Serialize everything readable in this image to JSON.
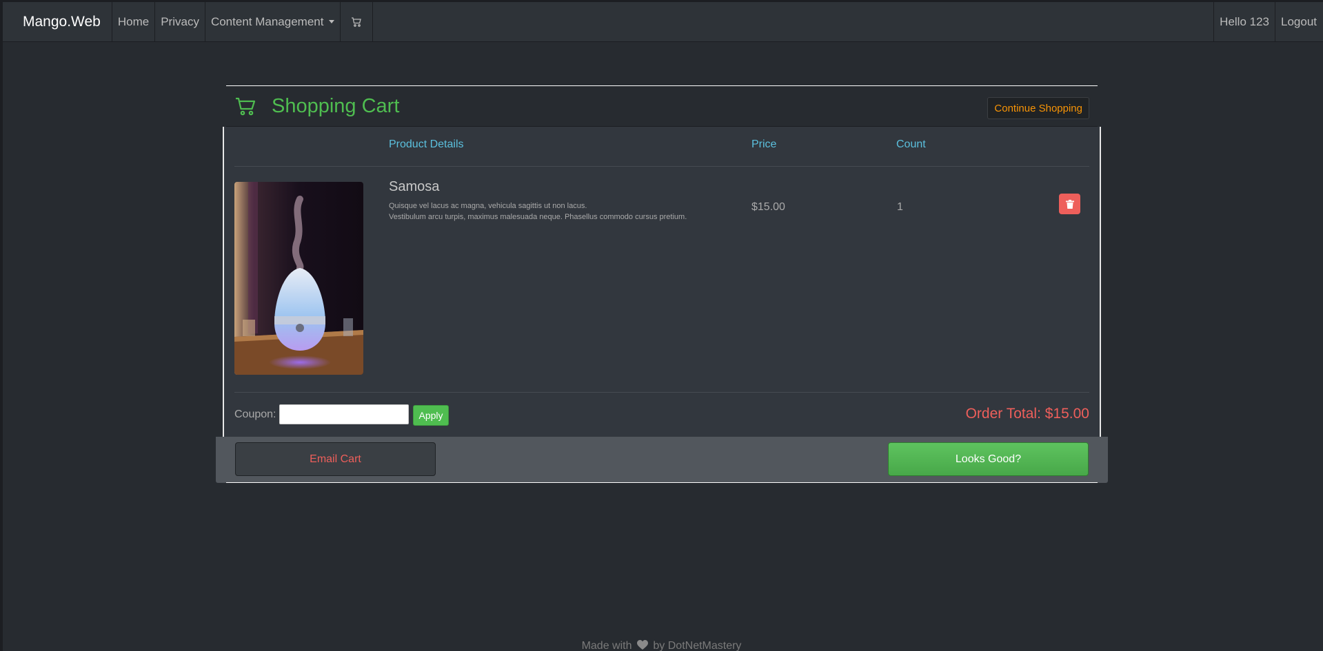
{
  "navbar": {
    "brand": "Mango.Web",
    "links": [
      "Home",
      "Privacy"
    ],
    "dropdown_label": "Content Management",
    "greeting": "Hello 123",
    "logout": "Logout"
  },
  "cart": {
    "title": "Shopping Cart",
    "continue_label": "Continue Shopping",
    "columns": {
      "details": "Product Details",
      "price": "Price",
      "count": "Count"
    },
    "items": [
      {
        "name": "Samosa",
        "description_line1": "Quisque vel lacus ac magna, vehicula sagittis ut non lacus.",
        "description_line2": "Vestibulum arcu turpis, maximus malesuada neque. Phasellus commodo cursus pretium.",
        "price": "$15.00",
        "count": "1"
      }
    ],
    "coupon_label": "Coupon:",
    "coupon_value": "",
    "apply_label": "Apply",
    "order_total": "Order Total: $15.00",
    "email_label": "Email Cart",
    "checkout_label": "Looks Good?"
  },
  "footer": {
    "prefix": "Made with",
    "suffix": "by DotNetMastery"
  },
  "colors": {
    "accent_green": "#4fbd50",
    "accent_blue": "#5bc0de",
    "accent_red": "#ee5f5b",
    "accent_orange": "#f89406"
  }
}
